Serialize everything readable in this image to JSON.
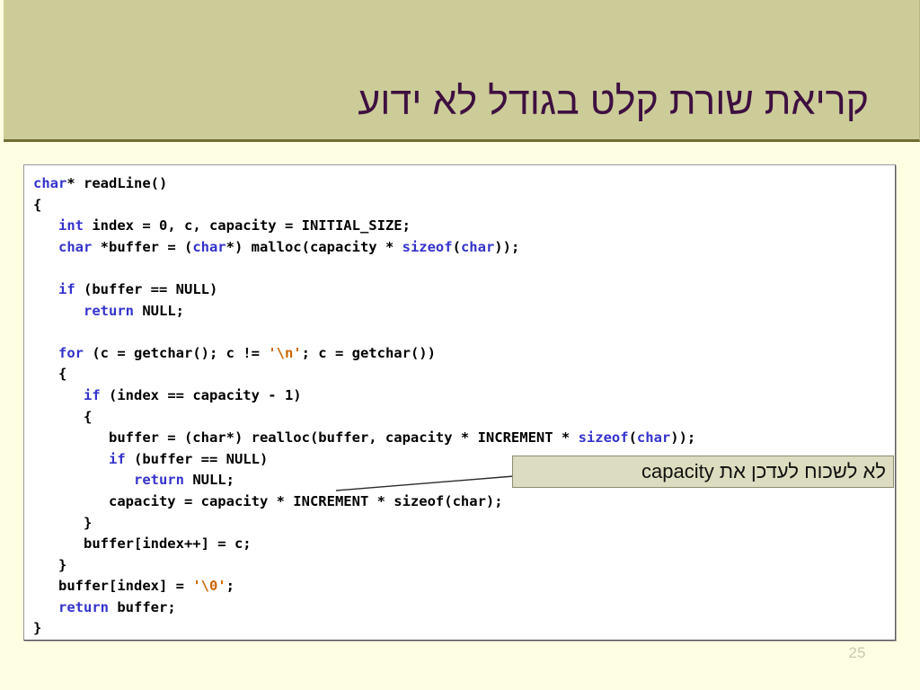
{
  "slide": {
    "title": "קריאת שורת קלט בגודל לא ידוע",
    "page_number": "25",
    "colors": {
      "band_background": "#CCCC99",
      "band_border": "#6E6E33",
      "title_text": "#3E1040",
      "page_background": "#FEFEE2",
      "code_background": "#FFFFFF",
      "code_border": "#9A9A9A",
      "keyword": "#3333CC",
      "string_literal": "#CC6600",
      "callout_background": "#DCDCC0",
      "callout_border": "#8C8C6E",
      "page_number_text": "#C9C9B0"
    }
  },
  "code": {
    "language": "c",
    "lines": [
      [
        {
          "t": "char",
          "c": "kw"
        },
        {
          "t": "* readLine()",
          "c": ""
        }
      ],
      [
        {
          "t": "{",
          "c": ""
        }
      ],
      [
        {
          "t": "   ",
          "c": ""
        },
        {
          "t": "int",
          "c": "kw"
        },
        {
          "t": " index = 0, c, capacity = INITIAL_SIZE;",
          "c": ""
        }
      ],
      [
        {
          "t": "   ",
          "c": ""
        },
        {
          "t": "char",
          "c": "kw"
        },
        {
          "t": " *buffer = (",
          "c": ""
        },
        {
          "t": "char",
          "c": "kw"
        },
        {
          "t": "*) malloc(capacity * ",
          "c": ""
        },
        {
          "t": "sizeof",
          "c": "kw"
        },
        {
          "t": "(",
          "c": ""
        },
        {
          "t": "char",
          "c": "kw"
        },
        {
          "t": "));",
          "c": ""
        }
      ],
      [
        {
          "t": "",
          "c": ""
        }
      ],
      [
        {
          "t": "   ",
          "c": ""
        },
        {
          "t": "if",
          "c": "kw"
        },
        {
          "t": " (buffer == NULL)",
          "c": ""
        }
      ],
      [
        {
          "t": "      ",
          "c": ""
        },
        {
          "t": "return",
          "c": "kw"
        },
        {
          "t": " NULL;",
          "c": ""
        }
      ],
      [
        {
          "t": "",
          "c": ""
        }
      ],
      [
        {
          "t": "   ",
          "c": ""
        },
        {
          "t": "for",
          "c": "kw"
        },
        {
          "t": " (c = getchar(); c != ",
          "c": ""
        },
        {
          "t": "'\\n'",
          "c": "str"
        },
        {
          "t": "; c = getchar())",
          "c": ""
        }
      ],
      [
        {
          "t": "   {",
          "c": ""
        }
      ],
      [
        {
          "t": "      ",
          "c": ""
        },
        {
          "t": "if",
          "c": "kw"
        },
        {
          "t": " (index == capacity - 1)",
          "c": ""
        }
      ],
      [
        {
          "t": "      {",
          "c": ""
        }
      ],
      [
        {
          "t": "         buffer = (char*) realloc(buffer, capacity * INCREMENT * ",
          "c": ""
        },
        {
          "t": "sizeof",
          "c": "kw"
        },
        {
          "t": "(",
          "c": ""
        },
        {
          "t": "char",
          "c": "kw"
        },
        {
          "t": "));",
          "c": ""
        }
      ],
      [
        {
          "t": "         ",
          "c": ""
        },
        {
          "t": "if",
          "c": "kw"
        },
        {
          "t": " (buffer == NULL)",
          "c": ""
        }
      ],
      [
        {
          "t": "            ",
          "c": ""
        },
        {
          "t": "return",
          "c": "kw"
        },
        {
          "t": " NULL;",
          "c": ""
        }
      ],
      [
        {
          "t": "         capacity = capacity * INCREMENT * sizeof(char);",
          "c": ""
        }
      ],
      [
        {
          "t": "      }",
          "c": ""
        }
      ],
      [
        {
          "t": "      buffer[index++] = c;",
          "c": ""
        }
      ],
      [
        {
          "t": "   }",
          "c": ""
        }
      ],
      [
        {
          "t": "   buffer[index] = ",
          "c": ""
        },
        {
          "t": "'\\0'",
          "c": "str"
        },
        {
          "t": ";",
          "c": ""
        }
      ],
      [
        {
          "t": "   ",
          "c": ""
        },
        {
          "t": "return",
          "c": "kw"
        },
        {
          "t": " buffer;",
          "c": ""
        }
      ],
      [
        {
          "t": "}",
          "c": ""
        }
      ]
    ]
  },
  "callout": {
    "text": "לא לשכוח לעדכן את capacity"
  }
}
